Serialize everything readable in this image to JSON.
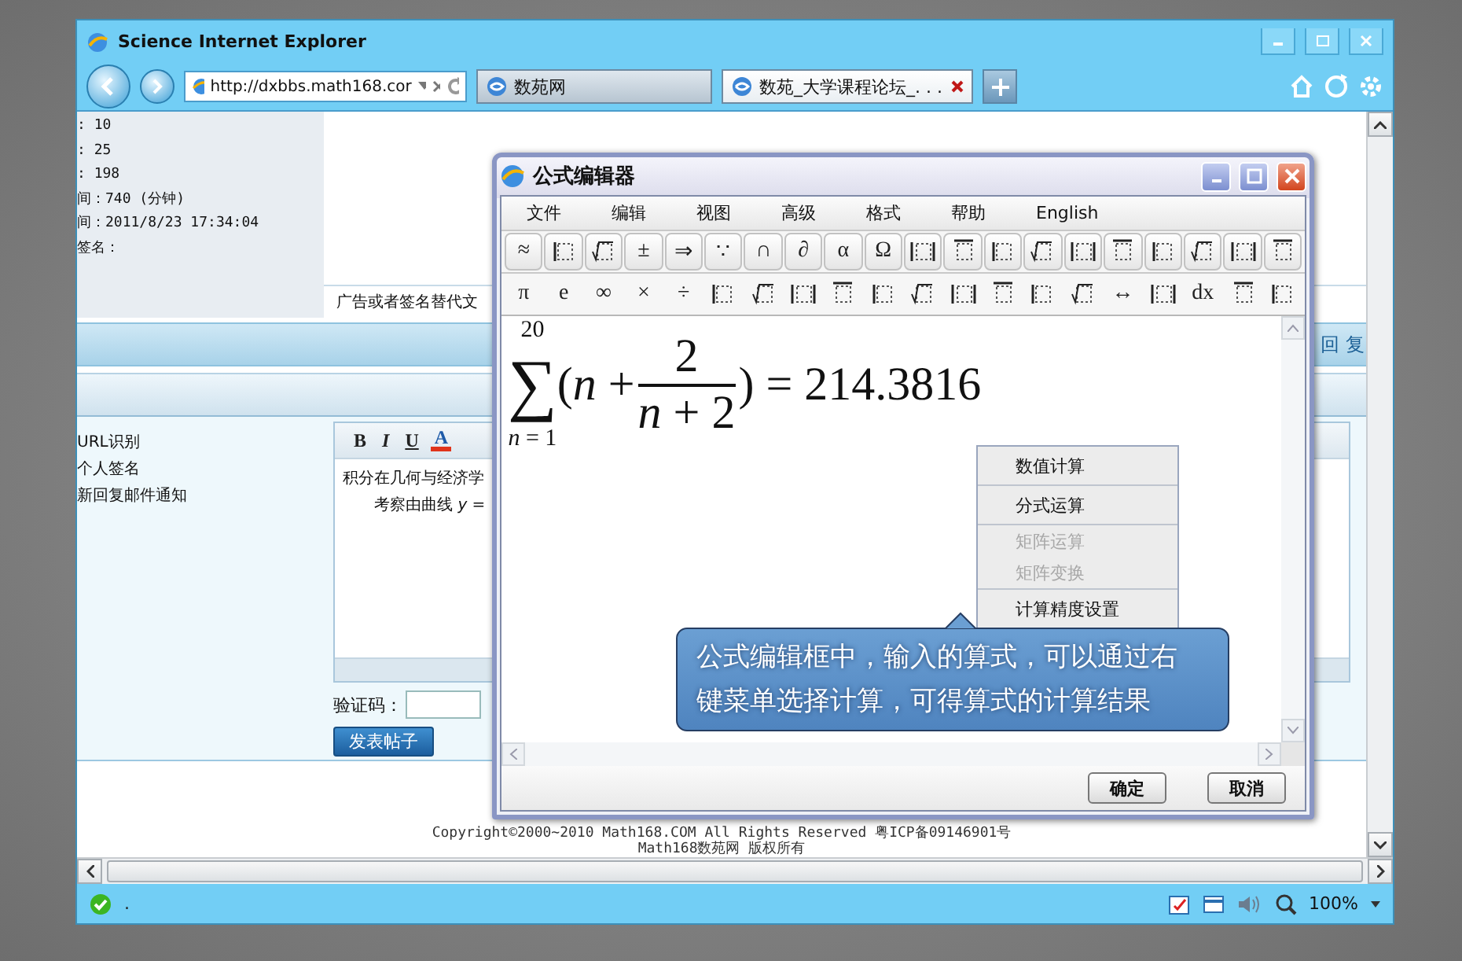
{
  "browser": {
    "title": "Science Internet Explorer",
    "address": {
      "value": "http://dxbbs.math168.cor"
    },
    "tabs": [
      {
        "label": "数苑网",
        "selected": false
      },
      {
        "label": "数苑_大学课程论坛_. . .",
        "selected": true
      }
    ]
  },
  "page": {
    "stats": [
      ": 10",
      ": 25",
      ": 198",
      "间：740 (分钟)",
      "间：2011/8/23 17:34:04",
      "签名："
    ],
    "ad_text": "广告或者签名替代文",
    "reply_bar": "回 复",
    "options": [
      "URL识别",
      "个人签名",
      "新回复邮件通知"
    ],
    "editor": {
      "toolbar": [
        {
          "kind": "bold",
          "label": "B"
        },
        {
          "kind": "italic",
          "label": "I"
        },
        {
          "kind": "underline",
          "label": "U"
        },
        {
          "kind": "color",
          "label": "A"
        }
      ],
      "lines": [
        "积分在几何与经济学",
        "考察由曲线 *y* ="
      ]
    },
    "captcha": {
      "label": "验证码："
    },
    "submit": "发表帖子",
    "footer": [
      "Copyright©2000~2010 Math168.COM All Rights Reserved 粤ICP备09146901号",
      "Math168数苑网 版权所有"
    ]
  },
  "dialog": {
    "title": "公式编辑器",
    "menu": [
      "文件",
      "编辑",
      "视图",
      "高级",
      "格式",
      "帮助",
      "English"
    ],
    "toolbar_rows": [
      [
        {
          "kind": "symbol",
          "label": "≈"
        },
        {
          "kind": "template"
        },
        {
          "kind": "template"
        },
        {
          "kind": "symbol",
          "label": "±"
        },
        {
          "kind": "symbol",
          "label": "⇒"
        },
        {
          "kind": "symbol",
          "label": "∵"
        },
        {
          "kind": "symbol",
          "label": "∩"
        },
        {
          "kind": "symbol",
          "label": "∂"
        },
        {
          "kind": "symbol",
          "label": "α"
        },
        {
          "kind": "symbol",
          "label": "Ω"
        },
        {
          "kind": "template"
        },
        {
          "kind": "template"
        },
        {
          "kind": "template"
        },
        {
          "kind": "template"
        },
        {
          "kind": "template"
        },
        {
          "kind": "template"
        },
        {
          "kind": "template"
        },
        {
          "kind": "template"
        },
        {
          "kind": "template"
        },
        {
          "kind": "template"
        }
      ],
      [
        {
          "kind": "symbol",
          "label": "π"
        },
        {
          "kind": "symbol",
          "label": "e"
        },
        {
          "kind": "symbol",
          "label": "∞"
        },
        {
          "kind": "symbol",
          "label": "×"
        },
        {
          "kind": "symbol",
          "label": "÷"
        },
        {
          "kind": "template"
        },
        {
          "kind": "template"
        },
        {
          "kind": "template"
        },
        {
          "kind": "template"
        },
        {
          "kind": "template"
        },
        {
          "kind": "template"
        },
        {
          "kind": "template"
        },
        {
          "kind": "template"
        },
        {
          "kind": "template"
        },
        {
          "kind": "template"
        },
        {
          "kind": "symbol",
          "label": "↔"
        },
        {
          "kind": "template"
        },
        {
          "kind": "symbol",
          "label": "dx"
        },
        {
          "kind": "template"
        },
        {
          "kind": "template"
        }
      ]
    ],
    "formula": {
      "sigma": "∑",
      "upper": "20",
      "lower": "*n* = 1",
      "open": "(*n* +",
      "numerator": "2",
      "denominator": "*n* + 2",
      "close": ") = 214.3816"
    },
    "context_menu": [
      {
        "label": "数值计算",
        "disabled": false
      },
      {
        "label": "分式运算",
        "disabled": false
      },
      {
        "label": "矩阵运算",
        "disabled": true
      },
      {
        "label": "矩阵变换",
        "disabled": true
      },
      {
        "label": "计算精度设置",
        "disabled": false
      }
    ],
    "callout": "公式编辑框中，输入的算式，可以通过右键菜单选择计算，可得算式的计算结果",
    "buttons": [
      "确定",
      "取消"
    ]
  },
  "status_bar": {
    "text": ".",
    "zoom": "100%"
  }
}
